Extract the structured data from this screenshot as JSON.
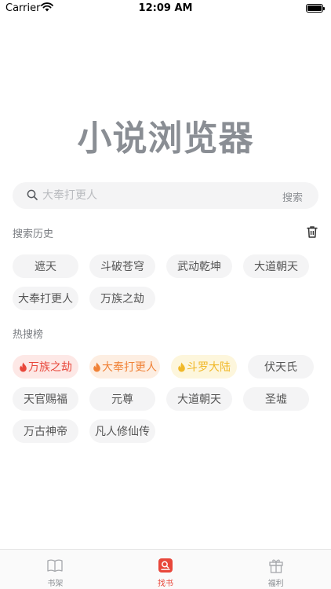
{
  "status_bar": {
    "carrier": "Carrier",
    "time": "12:09 AM"
  },
  "app": {
    "logo_text": "小说浏览器"
  },
  "search": {
    "placeholder": "大奉打更人",
    "button_label": "搜索"
  },
  "history": {
    "title": "搜索历史",
    "items": [
      "遮天",
      "斗破苍穹",
      "武动乾坤",
      "大道朝天",
      "大奉打更人",
      "万族之劫"
    ]
  },
  "hot": {
    "title": "热搜榜",
    "top_items": [
      {
        "label": "万族之劫",
        "color": "#e8473b"
      },
      {
        "label": "大奉打更人",
        "color": "#f08237"
      },
      {
        "label": "斗罗大陆",
        "color": "#f0b828"
      }
    ],
    "items": [
      "伏天氏",
      "天官赐福",
      "元尊",
      "大道朝天",
      "圣墟",
      "万古神帝",
      "凡人修仙传"
    ]
  },
  "tab_bar": {
    "tabs": [
      {
        "label": "书架",
        "icon": "book-icon",
        "active": false
      },
      {
        "label": "找书",
        "icon": "find-book-icon",
        "active": true
      },
      {
        "label": "福利",
        "icon": "gift-icon",
        "active": false
      }
    ]
  },
  "colors": {
    "accent": "#e8473b",
    "tag_bg": "#f4f4f5",
    "logo": "#8a8e94"
  }
}
